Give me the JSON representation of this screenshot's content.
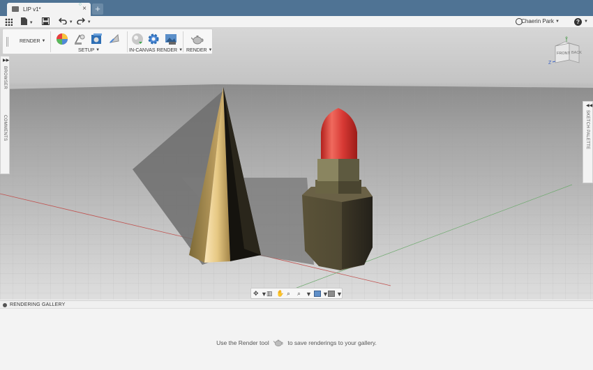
{
  "tab": {
    "title": "LIP v1*",
    "close": "×",
    "new_tab": "+"
  },
  "user": {
    "name": "Chaerin Park"
  },
  "help": {
    "label": "?"
  },
  "ribbon": {
    "workspace": "RENDER",
    "groups": {
      "setup": "SETUP",
      "in_canvas": "IN-CANVAS RENDER",
      "render": "RENDER"
    }
  },
  "panels": {
    "browser": "BROWSER",
    "comments": "COMMENTS",
    "sketch_palette": "SKETCH PALETTE"
  },
  "viewcube": {
    "front": "FRONT",
    "back": "BACK",
    "axis_z": "Z",
    "axis_y": "Y"
  },
  "gallery": {
    "title": "RENDERING GALLERY",
    "message_before": "Use the Render tool",
    "message_after": "to save renderings to your gallery."
  },
  "colors": {
    "tabbar": "#4f7394",
    "lipstick_red": "#d83a35",
    "gold": "#b89a55",
    "case_dark": "#3f3a2a"
  }
}
